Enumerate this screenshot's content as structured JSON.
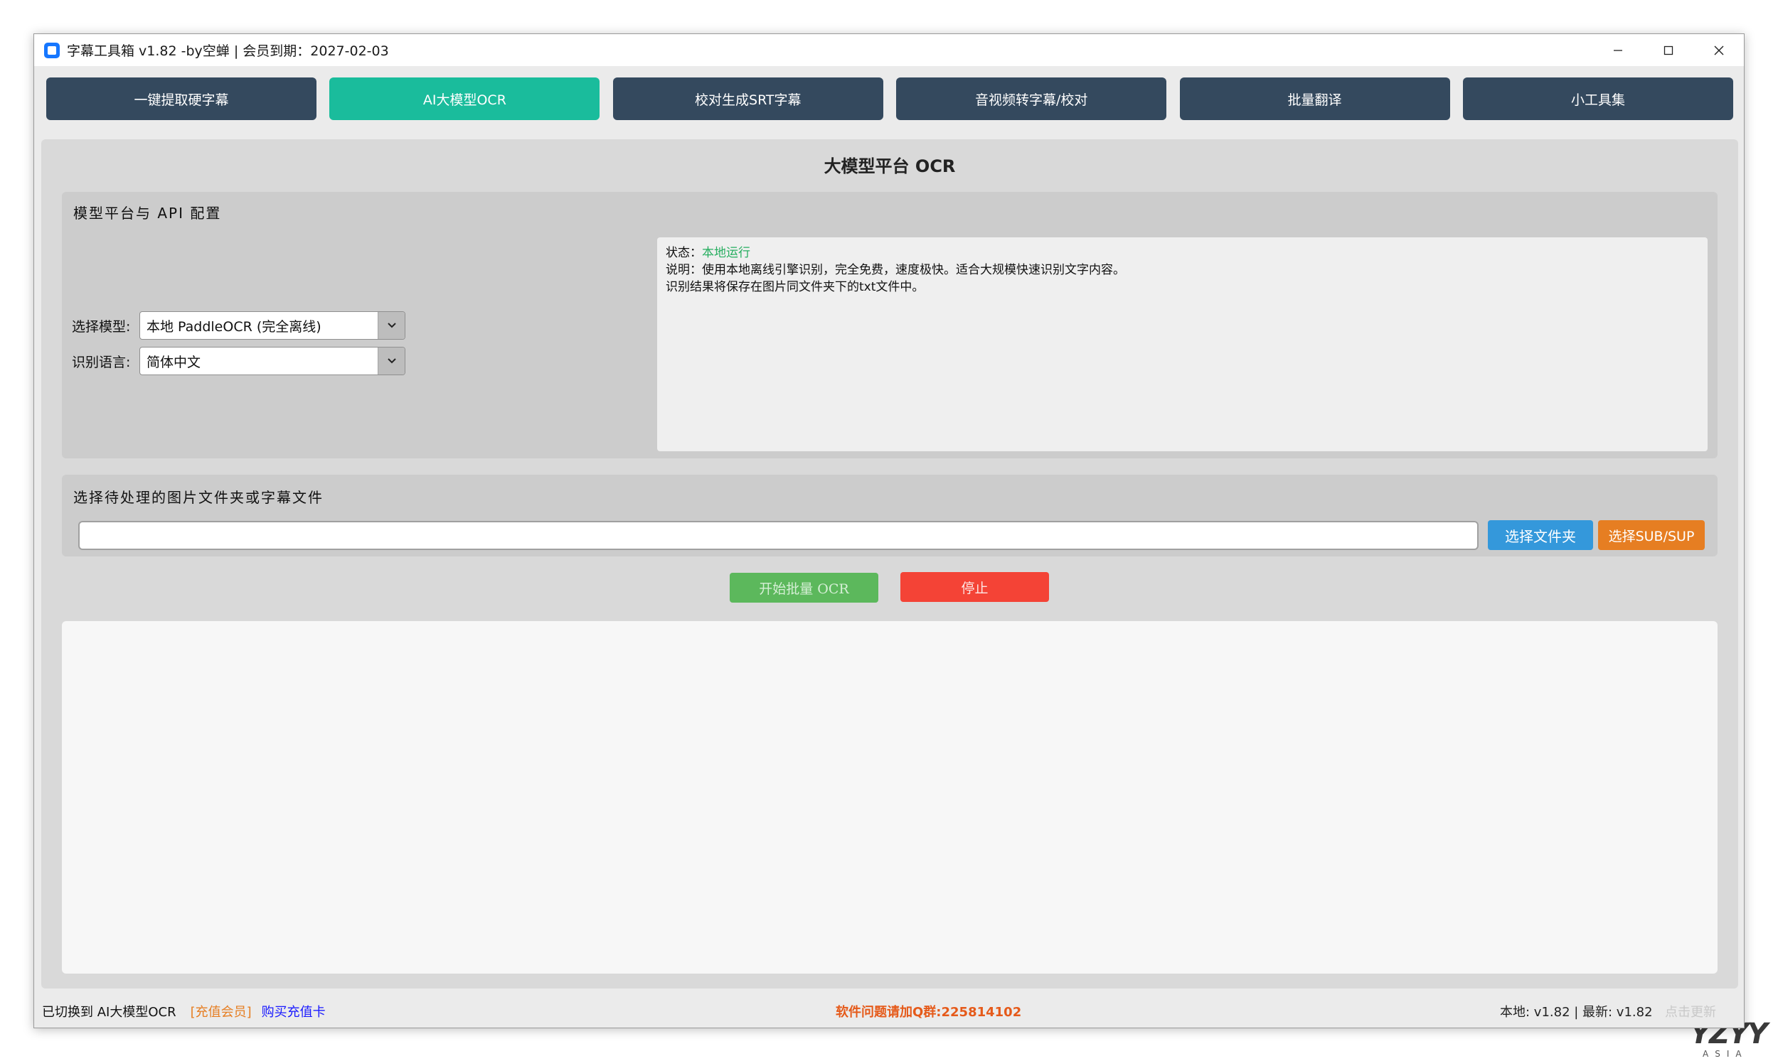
{
  "window": {
    "title": "字幕工具箱 v1.82 -by空蝉 | 会员到期：2027-02-03"
  },
  "tabs": [
    {
      "label": "一键提取硬字幕"
    },
    {
      "label": "AI大模型OCR"
    },
    {
      "label": "校对生成SRT字幕"
    },
    {
      "label": "音视频转字幕/校对"
    },
    {
      "label": "批量翻译"
    },
    {
      "label": "小工具集"
    }
  ],
  "active_tab": "AI大模型OCR",
  "section_title": "大模型平台 OCR",
  "config": {
    "group_label": "模型平台与 API 配置",
    "model_label": "选择模型:",
    "model_value": "本地 PaddleOCR (完全离线)",
    "lang_label": "识别语言:",
    "lang_value": "简体中文",
    "info": {
      "status_label": "状态：",
      "status_value": "本地运行",
      "desc_line1": "说明：使用本地离线引擎识别，完全免费，速度极快。适合大规模快速识别文字内容。",
      "desc_line2": "识别结果将保存在图片同文件夹下的txt文件中。"
    }
  },
  "files": {
    "group_label": "选择待处理的图片文件夹或字幕文件",
    "path_value": "",
    "folder_button": "选择文件夹",
    "sub_button": "选择SUB/SUP"
  },
  "actions": {
    "start_button": "开始批量 OCR",
    "stop_button": "停止"
  },
  "log_text": "",
  "statusbar": {
    "message": "已切换到 AI大模型OCR",
    "vip_link": "[充值会员]",
    "buy_link": "购买充值卡",
    "qq_notice": "软件问题请加Q群:225814102",
    "version": "本地: v1.82 | 最新: v1.82",
    "update_link": "点击更新"
  },
  "watermark": {
    "logo_text": "YZYY",
    "sub_text": "ASIA"
  },
  "colors": {
    "tab_bg": "#34495e",
    "tab_active_bg": "#1abc9c",
    "folder_button": "#3498db",
    "sub_button": "#e67e22",
    "start_button": "#5cb85c",
    "stop_button": "#f44336",
    "status_ok": "#27ae60"
  }
}
